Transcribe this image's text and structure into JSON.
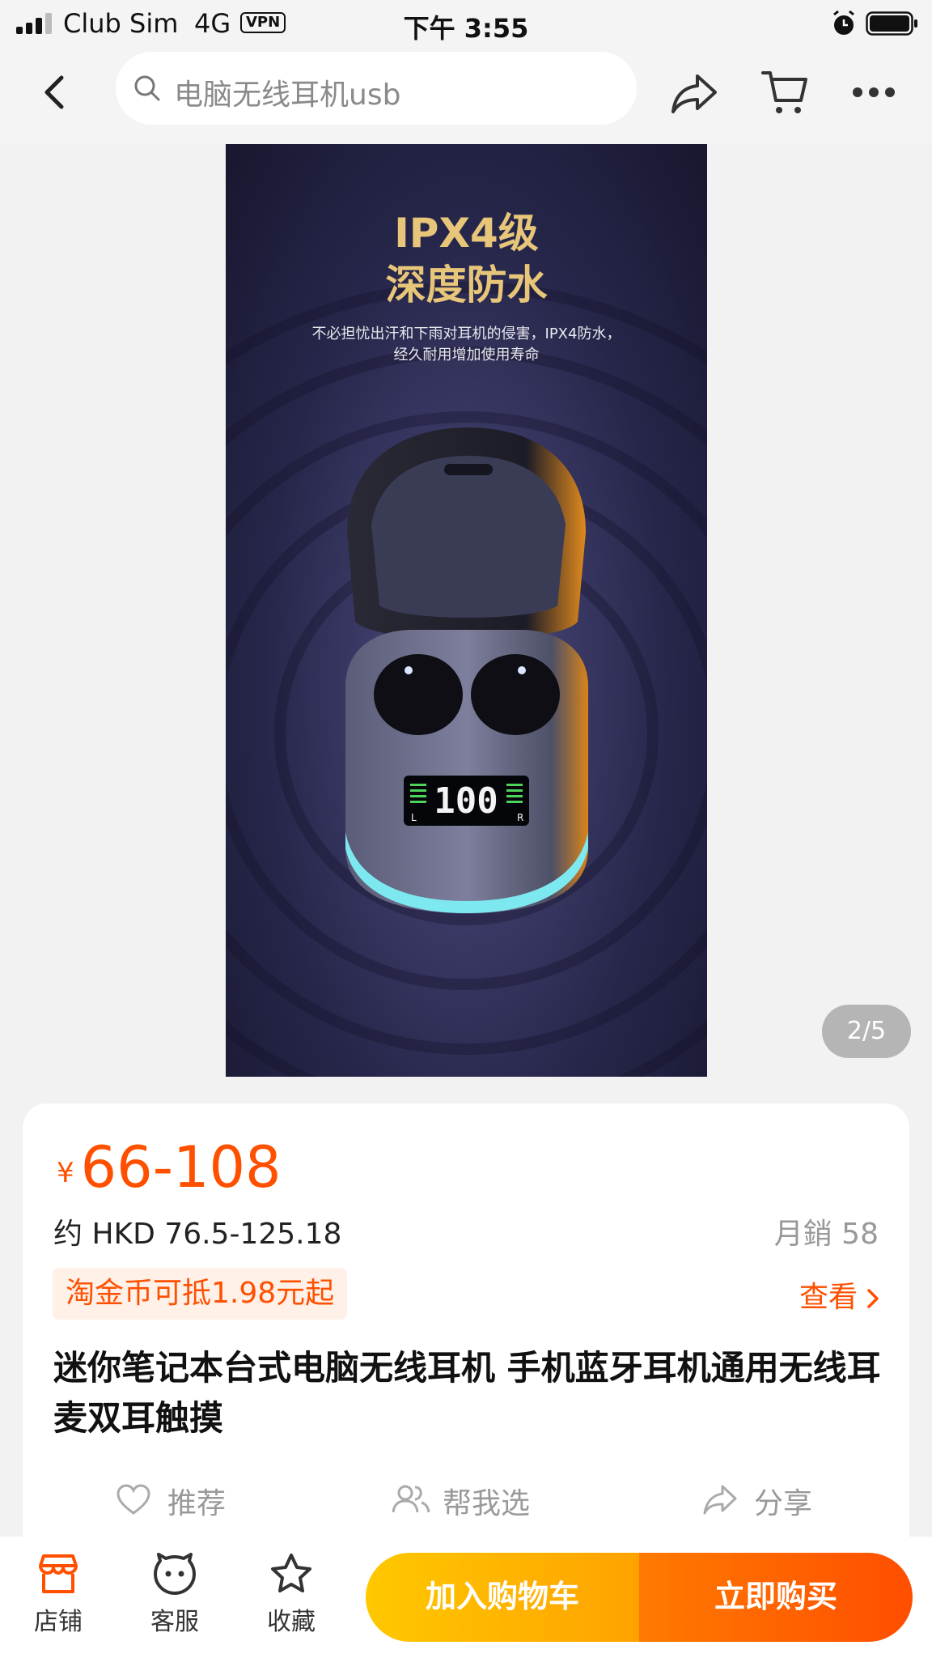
{
  "status_bar": {
    "carrier": "Club Sim",
    "network": "4G",
    "vpn": "VPN",
    "time": "下午 3:55"
  },
  "nav": {
    "search_text": "电脑无线耳机usb",
    "icons": [
      "back-icon",
      "search-icon",
      "share-icon",
      "cart-icon",
      "more-icon"
    ]
  },
  "gallery": {
    "image_headline_1": "IPX4级",
    "image_headline_2": "深度防水",
    "image_sub_1": "不必担忧出汗和下雨对耳机的侵害，IPX4防水，",
    "image_sub_2": "经久耐用增加使用寿命",
    "display_value": "100",
    "display_left": "L",
    "display_right": "R",
    "page_indicator": "2/5"
  },
  "product": {
    "currency_symbol": "¥",
    "price": "66-108",
    "hkd_price": "约 HKD 76.5-125.18",
    "monthly_sales": "月銷 58",
    "coin_offer": "淘金币可抵1.98元起",
    "view_label": "查看",
    "title": "迷你笔记本台式电脑无线耳机 手机蓝牙耳机通用无线耳麦双耳触摸"
  },
  "actions": {
    "recommend": "推荐",
    "help_choose": "帮我选",
    "share": "分享"
  },
  "bottom_bar": {
    "store": "店铺",
    "service": "客服",
    "favorite": "收藏",
    "add_to_cart": "加入购物车",
    "buy_now": "立即购买"
  },
  "colors": {
    "accent": "#ff5000",
    "cart_button": "#ffb400",
    "buy_button": "#ff6200",
    "headline_gold": "#e7c579"
  }
}
